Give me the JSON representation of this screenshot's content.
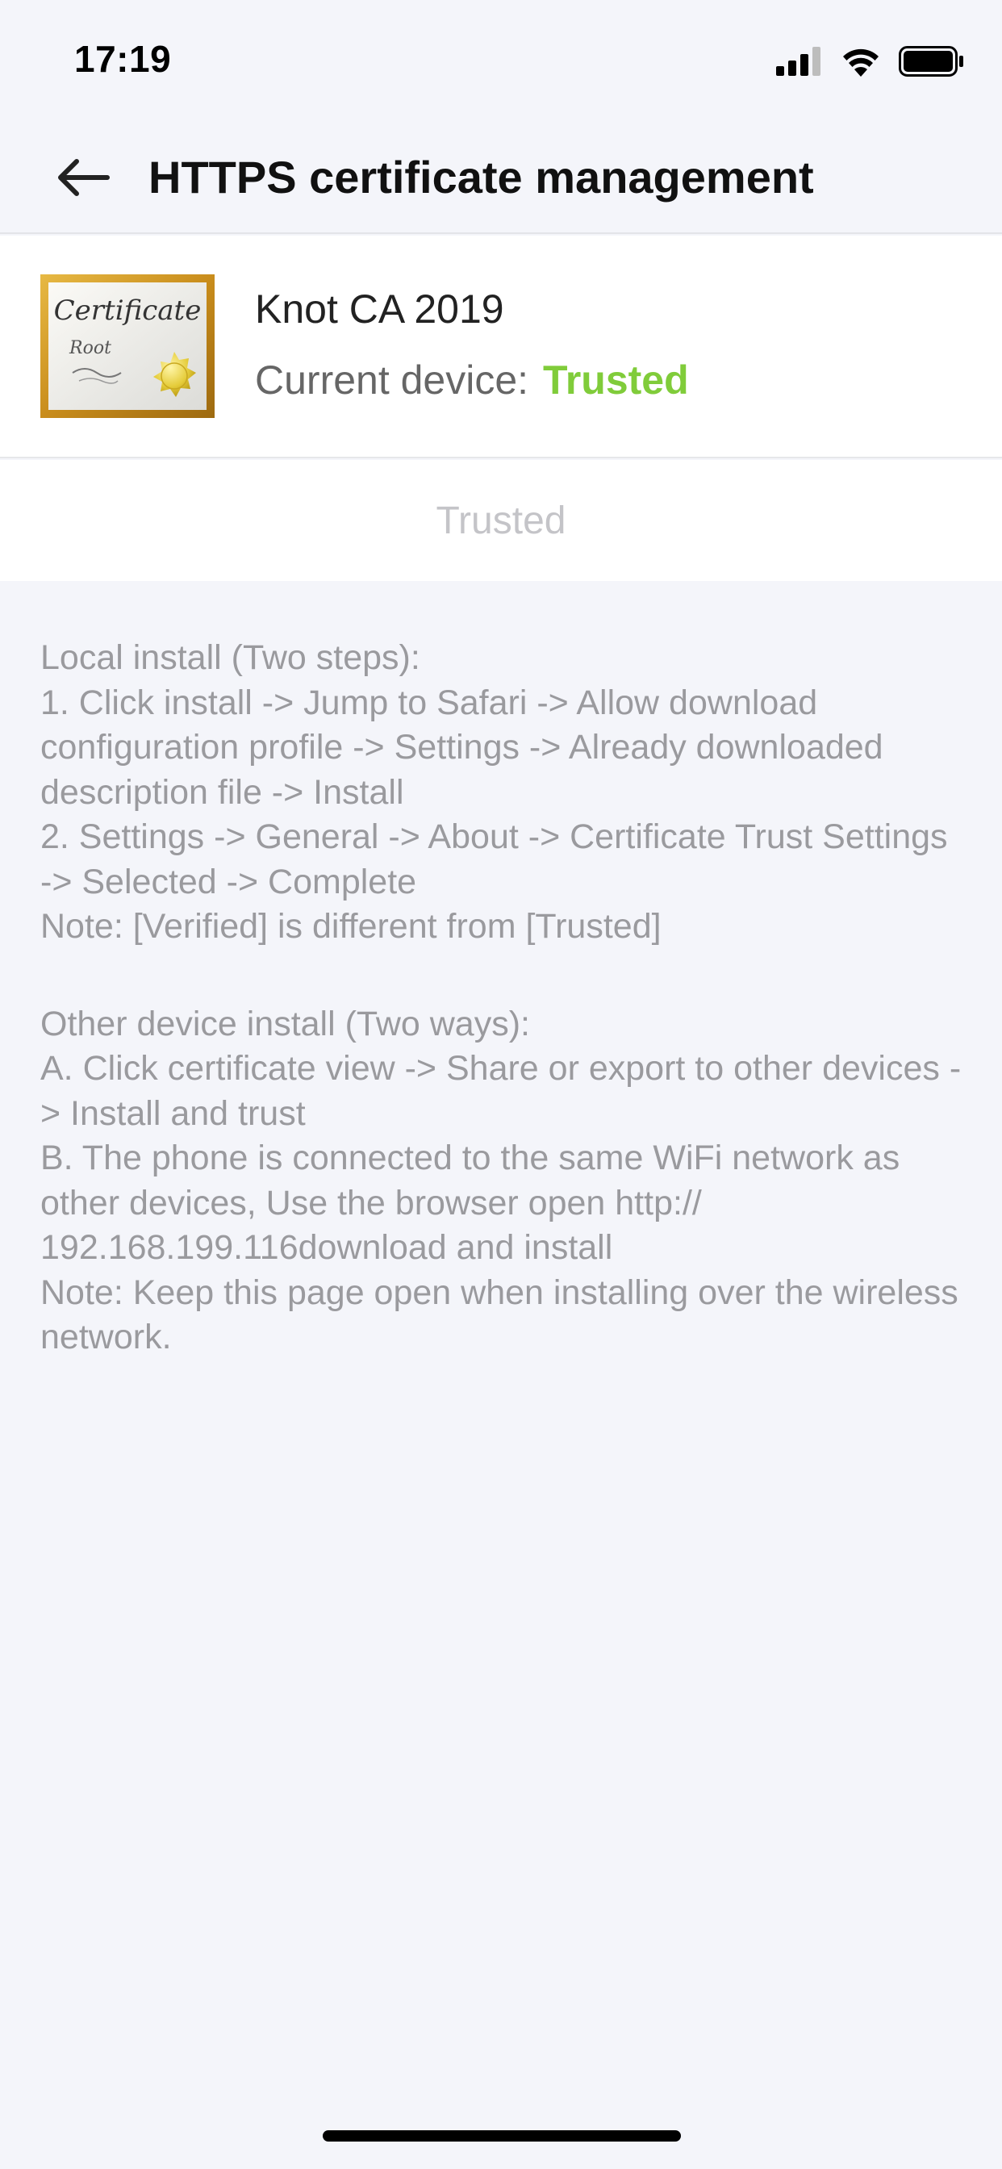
{
  "status_bar": {
    "time": "17:19",
    "icons": [
      "cellular-signal-icon",
      "wifi-icon",
      "battery-icon"
    ]
  },
  "nav": {
    "back_icon": "arrow-left-icon",
    "title": "HTTPS certificate management"
  },
  "certificate": {
    "image_icon": "certificate-root-icon",
    "image_text": "Certificate",
    "image_subtext": "Root",
    "name": "Knot CA 2019",
    "status_label": "Current device:",
    "status_value": "Trusted",
    "status_color": "#80cc3a"
  },
  "trust_button": {
    "label": "Trusted",
    "disabled": true
  },
  "instructions": {
    "local": [
      "Local install (Two steps):",
      "1. Click install -> Jump to Safari -> Allow download configuration profile -> Settings -> Already downloaded description file -> Install",
      "2. Settings -> General -> About -> Certificate Trust Settings -> Selected -> Complete",
      "Note: [Verified] is different from [Trusted]"
    ],
    "other": [
      "Other device install (Two ways):",
      "A. Click certificate view -> Share or export to other devices -> Install and trust",
      "B. The phone is connected to the same WiFi network as other devices, Use the browser open http:// 192.168.199.116download and install",
      "Note: Keep this page open when installing over the wireless network."
    ]
  }
}
